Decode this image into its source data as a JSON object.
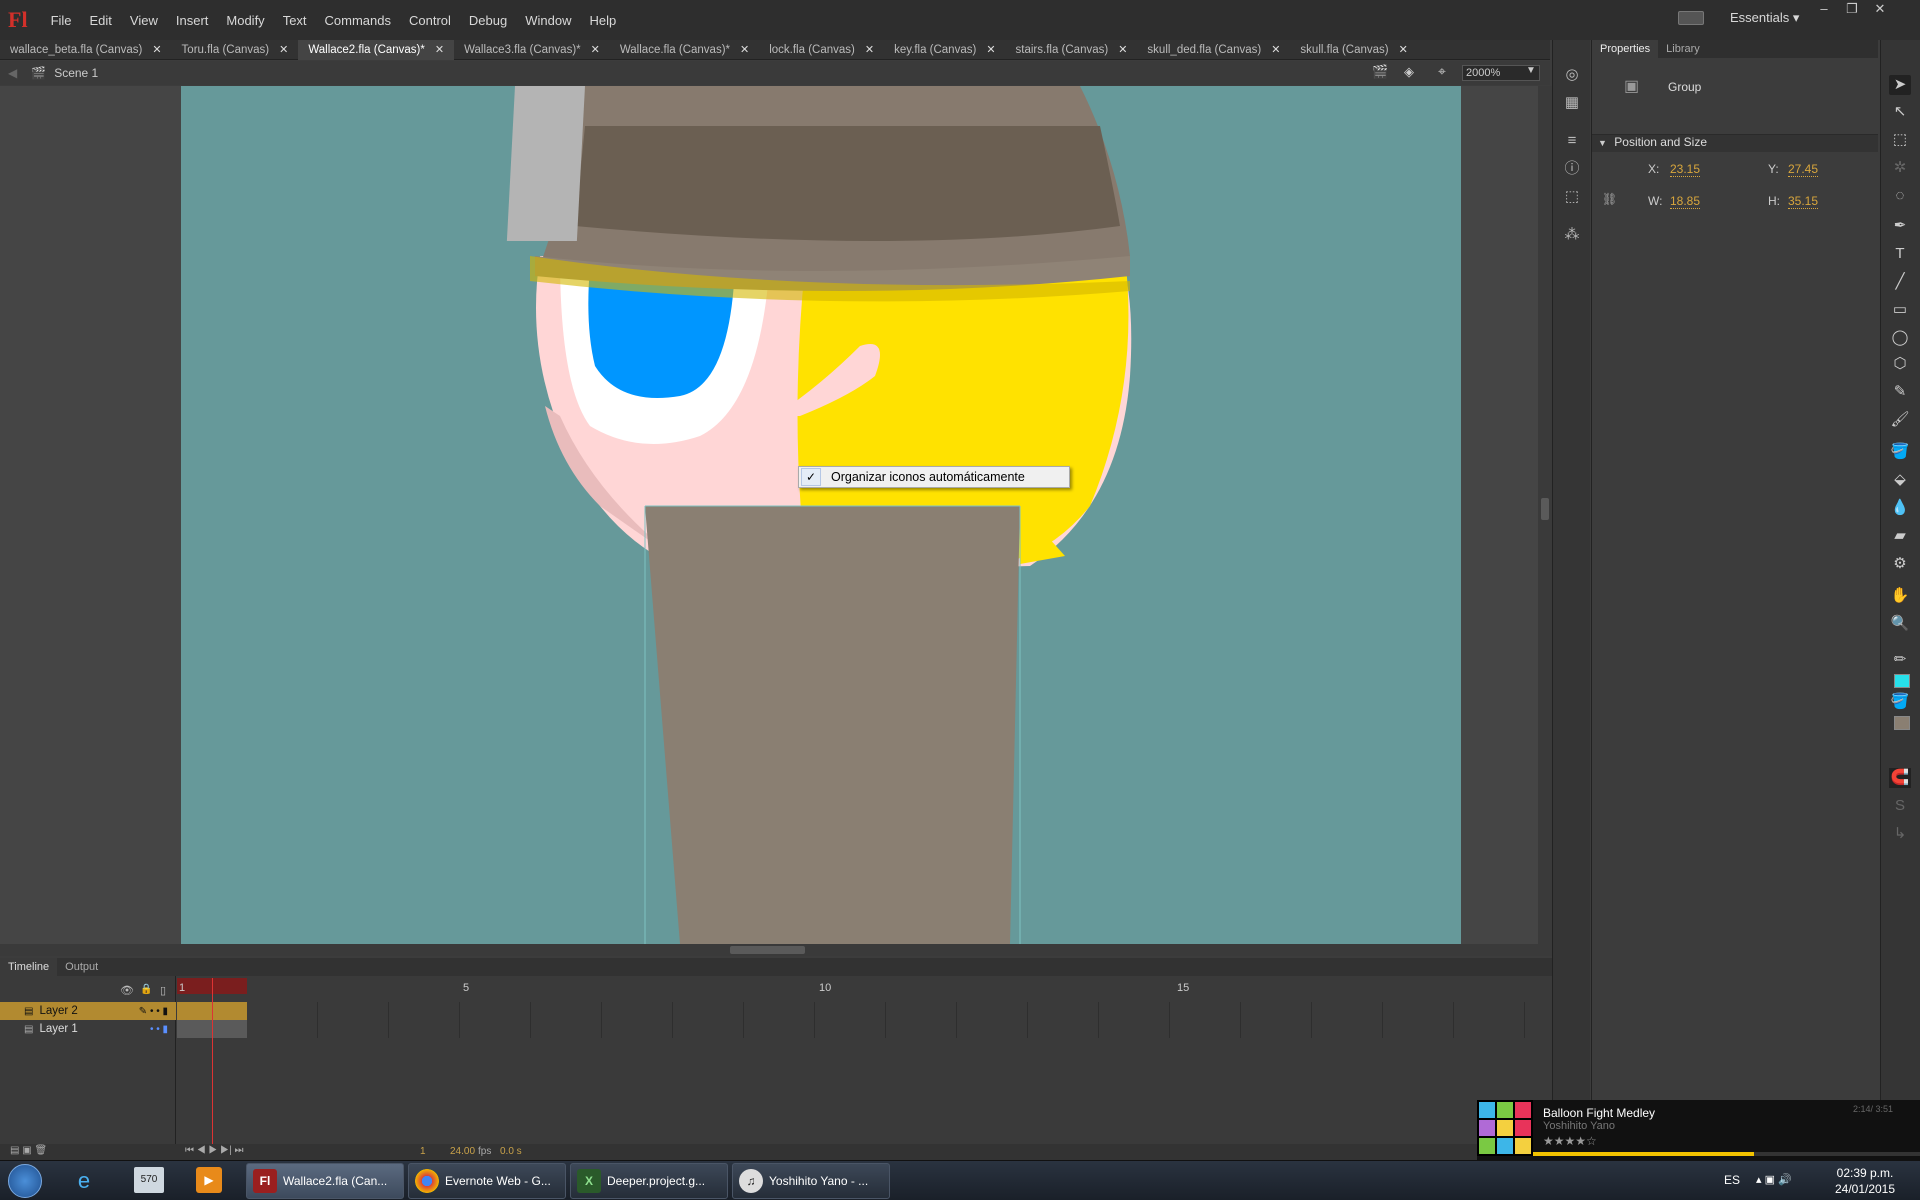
{
  "app": {
    "logo": "Fl",
    "workspace": "Essentials"
  },
  "menu": [
    "File",
    "Edit",
    "View",
    "Insert",
    "Modify",
    "Text",
    "Commands",
    "Control",
    "Debug",
    "Window",
    "Help"
  ],
  "tabs": [
    {
      "label": "wallace_beta.fla (Canvas)"
    },
    {
      "label": "Toru.fla (Canvas)"
    },
    {
      "label": "Wallace2.fla (Canvas)*",
      "active": true
    },
    {
      "label": "Wallace3.fla (Canvas)*"
    },
    {
      "label": "Wallace.fla (Canvas)*"
    },
    {
      "label": "lock.fla (Canvas)"
    },
    {
      "label": "key.fla (Canvas)"
    },
    {
      "label": "stairs.fla (Canvas)"
    },
    {
      "label": "skull_ded.fla (Canvas)"
    },
    {
      "label": "skull.fla (Canvas)"
    }
  ],
  "editbar": {
    "scene": "Scene 1",
    "zoom": "2000%"
  },
  "context_menu": {
    "item": "Organizar iconos automáticamente",
    "checked": true
  },
  "timeline": {
    "tabs": [
      "Timeline",
      "Output"
    ],
    "layers": [
      {
        "name": "Layer 2",
        "selected": true
      },
      {
        "name": "Layer 1",
        "selected": false
      }
    ],
    "frame_numbers": [
      "1",
      "5",
      "10",
      "15"
    ],
    "current_frame": "1",
    "fps": "24.00",
    "fps_unit": "fps",
    "time": "0.0 s"
  },
  "properties": {
    "tabs": [
      "Properties",
      "Library"
    ],
    "instance_type": "Group",
    "section": "Position and Size",
    "x_label": "X:",
    "x": "23.15",
    "y_label": "Y:",
    "y": "27.45",
    "w_label": "W:",
    "w": "18.85",
    "h_label": "H:",
    "h": "35.15"
  },
  "taskbar": {
    "tasks": [
      {
        "label": "Wallace2.fla (Can...",
        "icon": "flash-icon",
        "active": true
      },
      {
        "label": "Evernote Web - G...",
        "icon": "chrome-icon",
        "active": false
      },
      {
        "label": "Deeper.project.g...",
        "icon": "gamemaker-icon",
        "active": false
      },
      {
        "label": "Yoshihito Yano - ...",
        "icon": "media-player-icon",
        "active": false
      }
    ],
    "pinned_text": "570"
  },
  "media": {
    "title": "Balloon Fight Medley",
    "artist": "Yoshihito Yano",
    "time": "2:14/ 3:51",
    "progress": 0.57
  },
  "system": {
    "language": "ES",
    "time": "02:39 p.m.",
    "date": "24/01/2015"
  },
  "colors": {
    "stage_bg": "#66999a",
    "hair": "#ffe200",
    "eye": "#0096ff",
    "skin": "#ffd6d6",
    "hat": "#6b5f52",
    "body": "#8a7f72",
    "accent": "#c9a24a",
    "selection": "#b28a30"
  }
}
